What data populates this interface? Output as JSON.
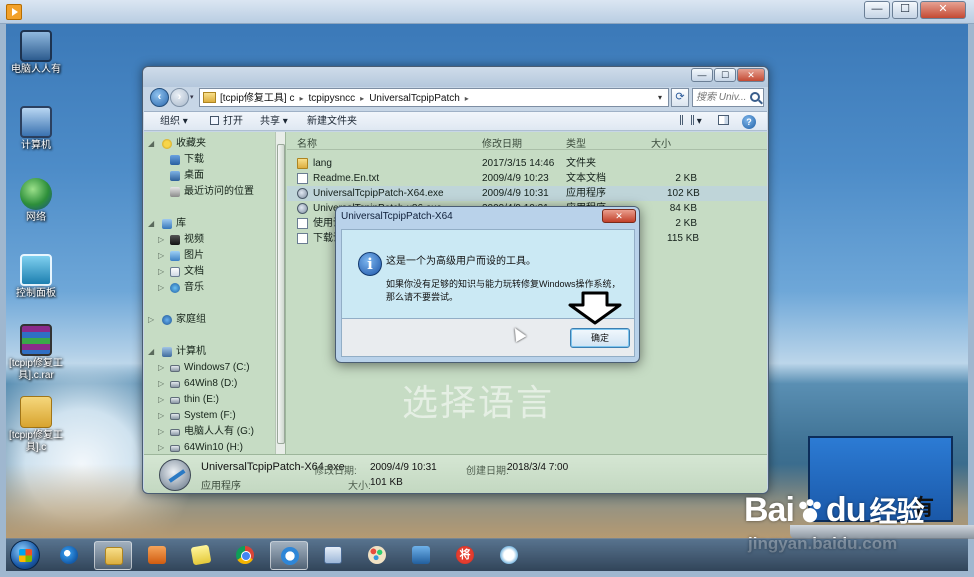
{
  "host": {
    "controls": {
      "minimize": "—",
      "maximize": "☐",
      "close": "✕"
    }
  },
  "desktop": {
    "icons": [
      {
        "label": "电脑人人有"
      },
      {
        "label": "计算机"
      },
      {
        "label": "网络"
      },
      {
        "label": "控制面板"
      },
      {
        "label": "[tcpip修复工具].c.rar"
      },
      {
        "label": "[tcpip修复工具].c"
      }
    ]
  },
  "explorer": {
    "address": {
      "segments": [
        "[tcpip修复工具] c",
        "tcpipysncc",
        "UniversalTcpipPatch"
      ],
      "separator": "▸"
    },
    "search_placeholder": "搜索 Univ...",
    "toolbar": {
      "organize": "组织 ▾",
      "open": "打开",
      "share": "共享 ▾",
      "new_folder": "新建文件夹"
    },
    "nav": {
      "favorites": "收藏夹",
      "downloads": "下载",
      "desktop": "桌面",
      "recent": "最近访问的位置",
      "libraries": "库",
      "videos": "视频",
      "pictures": "图片",
      "documents": "文档",
      "music": "音乐",
      "homegroup": "家庭组",
      "computer": "计算机",
      "drives": [
        "Windows7 (C:)",
        "64Win8 (D:)",
        "thin (E:)",
        "System (F:)",
        "电脑人人有 (G:)",
        "64Win10 (H:)"
      ]
    },
    "columns": {
      "name": "名称",
      "date": "修改日期",
      "type": "类型",
      "size": "大小"
    },
    "files": [
      {
        "name": "lang",
        "date": "2017/3/15 14:46",
        "type": "文件夹",
        "size": "",
        "icon": "folder"
      },
      {
        "name": "Readme.En.txt",
        "date": "2009/4/9 10:23",
        "type": "文本文档",
        "size": "2 KB",
        "icon": "txt"
      },
      {
        "name": "UniversalTcpipPatch-X64.exe",
        "date": "2009/4/9 10:31",
        "type": "应用程序",
        "size": "102 KB",
        "icon": "exe"
      },
      {
        "name": "UniversalTcpipPatch-x86.exe",
        "date": "2009/4/9 10:31",
        "type": "应用程序",
        "size": "84 KB",
        "icon": "exe"
      },
      {
        "name": "使用说明.txt",
        "date": "",
        "type": "",
        "size": "2 KB",
        "icon": "txt"
      },
      {
        "name": "下载说明.txt",
        "date": "",
        "type": "",
        "size": "115 KB",
        "icon": "txt"
      }
    ],
    "details": {
      "name": "UniversalTcpipPatch-X64.exe",
      "kind": "应用程序",
      "modified_label": "修改日期:",
      "modified": "2009/4/9 10:31",
      "size_label": "大小:",
      "size": "101 KB",
      "created_label": "创建日期:",
      "created": "2018/3/4 7:00"
    }
  },
  "dialog": {
    "title": "UniversalTcpipPatch-X64",
    "line1": "这是一个为高级用户而设的工具。",
    "line2": "如果你没有足够的知识与能力玩转修复Windows操作系统，",
    "line3": "那么请不要尝试。",
    "ok": "确定",
    "close": "✕"
  },
  "overlay": {
    "caption": "选择语言",
    "baidu_left": "Bai",
    "baidu_right": "du",
    "baidu_jingyan": "经验",
    "baidu_url": "jingyan.baidu.com",
    "card_text": "有"
  },
  "taskbar": {
    "apps": [
      {
        "name": "ie"
      },
      {
        "name": "explorer"
      },
      {
        "name": "media"
      },
      {
        "name": "notes"
      },
      {
        "name": "chrome"
      },
      {
        "name": "qq"
      },
      {
        "name": "word"
      },
      {
        "name": "paint"
      },
      {
        "name": "rdp"
      },
      {
        "name": "chess",
        "label": "将"
      },
      {
        "name": "cloud"
      }
    ]
  },
  "colors": {
    "accent": "#2c69ad",
    "dialog_bg": "#cbe9f4",
    "file_pane": "#c6dcc4"
  }
}
